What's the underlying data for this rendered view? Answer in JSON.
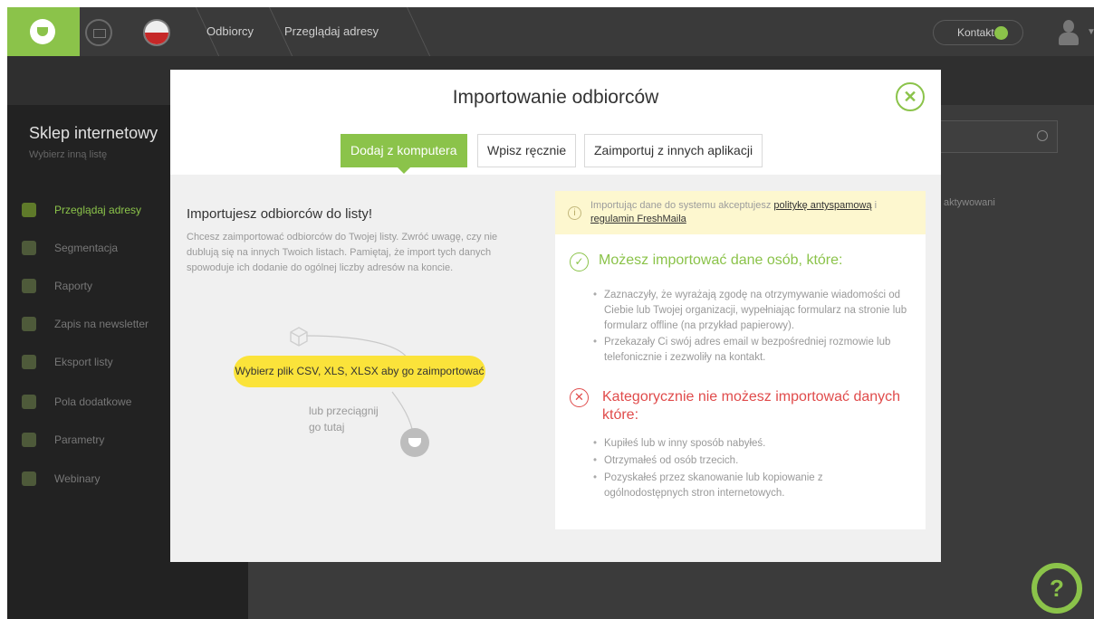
{
  "topbar": {
    "breadcrumbs": [
      "Odbiorcy",
      "Przeglądaj adresy"
    ],
    "contact_label": "Kontakt"
  },
  "sidebar": {
    "title": "Sklep internetowy",
    "subtitle": "Wybierz inną listę",
    "items": [
      {
        "label": "Przeglądaj adresy",
        "icon": "at-icon",
        "active": true
      },
      {
        "label": "Segmentacja",
        "icon": "grid-icon",
        "active": false
      },
      {
        "label": "Raporty",
        "icon": "pie-chart-icon",
        "active": false
      },
      {
        "label": "Zapis na newsletter",
        "icon": "envelope-icon",
        "active": false
      },
      {
        "label": "Eksport listy",
        "icon": "cloud-download-icon",
        "active": false
      },
      {
        "label": "Pola dodatkowe",
        "icon": "fields-icon",
        "active": false
      },
      {
        "label": "Parametry",
        "icon": "list-icon",
        "active": false
      },
      {
        "label": "Webinary",
        "icon": "monitor-icon",
        "active": false
      }
    ]
  },
  "background": {
    "inactive_label": "aktywowani"
  },
  "modal": {
    "title": "Importowanie odbiorców",
    "close_symbol": "✕",
    "tabs": [
      {
        "label": "Dodaj z komputera",
        "active": true
      },
      {
        "label": "Wpisz ręcznie",
        "active": false
      },
      {
        "label": "Zaimportuj z innych aplikacji",
        "active": false
      }
    ],
    "left": {
      "title": "Importujesz odbiorców do listy!",
      "description": "Chcesz zaimportować odbiorców do Twojej listy. Zwróć uwagę, czy nie dublują się na innych Twoich listach. Pamiętaj, że import tych danych spowoduje ich dodanie do ogólnej liczby adresów na koncie.",
      "upload_button": "Wybierz plik CSV, XLS, XLSX aby go zaimportować",
      "drag_text": "lub przeciągnij go tutaj"
    },
    "notice": {
      "prefix": "Importując dane do systemu akceptujesz ",
      "link1": "politykę antyspamową",
      "middle": " i ",
      "link2": "regulamin FreshMaila"
    },
    "can": {
      "title": "Możesz importować dane osób, które:",
      "items": [
        "Zaznaczyły, że wyrażają zgodę na otrzymywanie wiadomości od Ciebie lub Twojej organizacji, wypełniając formularz na stronie lub formularz offline (na przykład papierowy).",
        "Przekazały Ci swój adres email w bezpośredniej rozmowie lub telefonicznie i zezwoliły na kontakt."
      ]
    },
    "cannot": {
      "title": "Kategorycznie nie możesz importować danych które:",
      "items": [
        "Kupiłeś lub w inny sposób nabyłeś.",
        "Otrzymałeś od osób trzecich.",
        "Pozyskałeś przez skanowanie lub kopiowanie z ogólnodostępnych stron internetowych."
      ]
    }
  },
  "help_symbol": "?",
  "colors": {
    "accent": "#8bc34a",
    "upload": "#fbe33a",
    "error": "#e04b4b",
    "notice_bg": "#fdf7cf"
  }
}
